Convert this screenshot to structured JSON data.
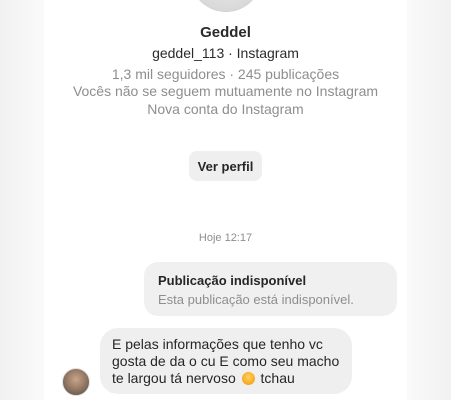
{
  "profile": {
    "name": "Geddel",
    "handle": "geddel_113 · Instagram",
    "stats": "1,3 mil seguidores · 245 publicações",
    "mutual": "Vocês não se seguem mutuamente no Instagram",
    "new_account": "Nova conta do Instagram",
    "view_profile_label": "Ver perfil"
  },
  "conversation": {
    "timestamp": "Hoje 12:17",
    "shared_post": {
      "title": "Publicação indisponível",
      "subtitle": "Esta publicação está indisponível."
    },
    "message": {
      "text_before_emoji": "E pelas informações que tenho vc gosta de da o cu E como seu macho te largou tá nervoso",
      "emoji_icon": "heart-eyes-emoji-icon",
      "text_after_emoji": "tchau"
    }
  }
}
